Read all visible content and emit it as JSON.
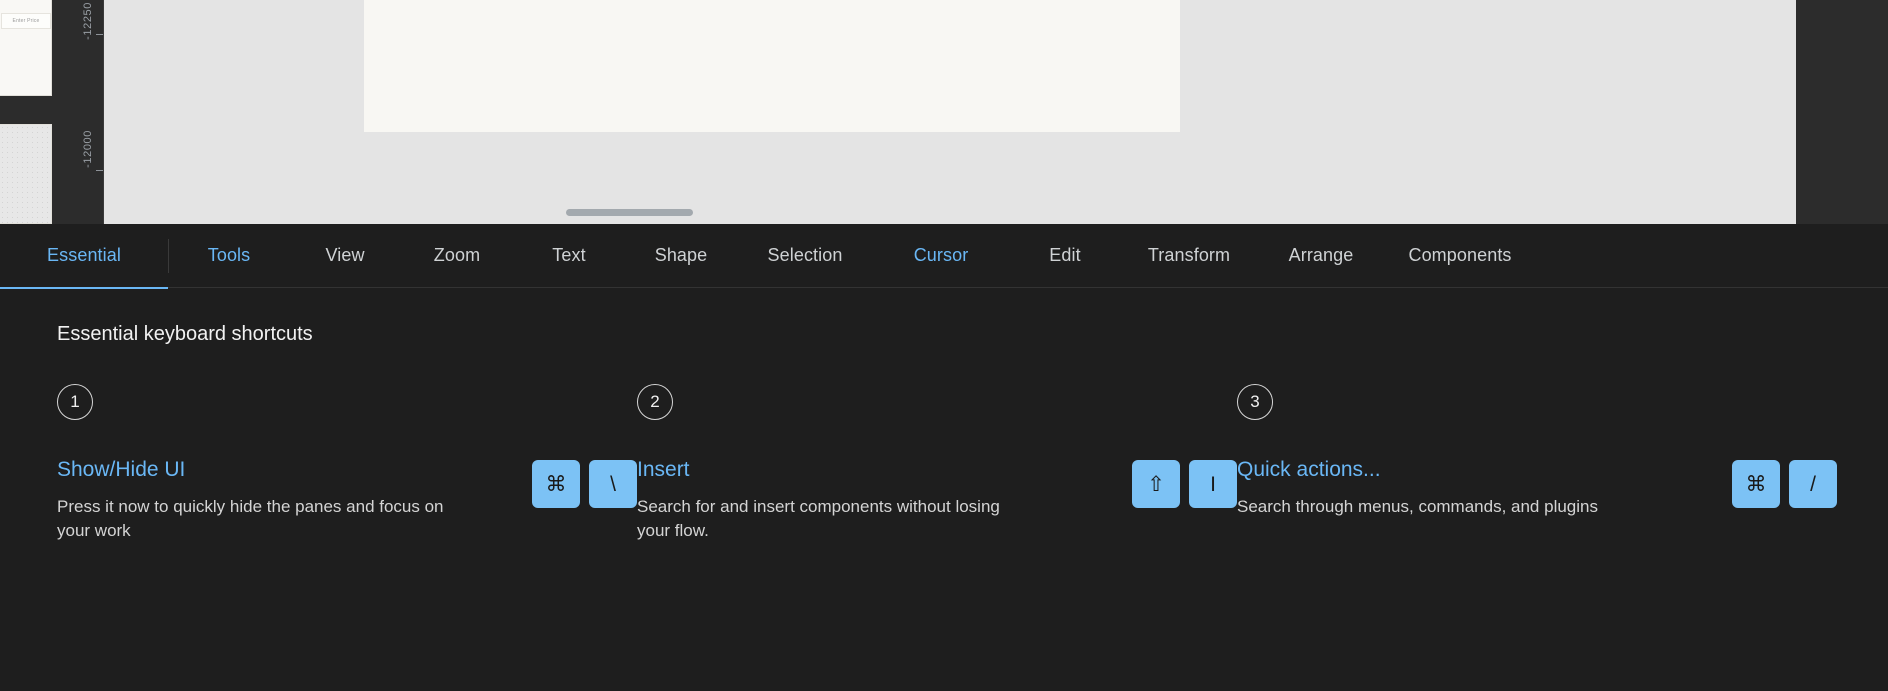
{
  "canvas": {
    "ruler": {
      "labels": [
        "-12250",
        "-12000"
      ]
    },
    "mini_card": {
      "field_placeholder": "Enter Price"
    },
    "expand_button_icon": "chevron-right-icon"
  },
  "tabs": [
    {
      "label": "Essential",
      "state": "active"
    },
    {
      "label": "Tools",
      "state": "accent"
    },
    {
      "label": "View",
      "state": "normal"
    },
    {
      "label": "Zoom",
      "state": "normal"
    },
    {
      "label": "Text",
      "state": "normal"
    },
    {
      "label": "Shape",
      "state": "normal"
    },
    {
      "label": "Selection",
      "state": "normal"
    },
    {
      "label": "Cursor",
      "state": "accent"
    },
    {
      "label": "Edit",
      "state": "normal"
    },
    {
      "label": "Transform",
      "state": "normal"
    },
    {
      "label": "Arrange",
      "state": "normal"
    },
    {
      "label": "Components",
      "state": "normal"
    }
  ],
  "panel": {
    "heading": "Essential keyboard shortcuts",
    "cards": [
      {
        "number": "1",
        "title": "Show/Hide UI",
        "description": "Press it now to quickly hide the panes and focus on your work",
        "keys": [
          {
            "glyph": "⌘",
            "name": "command-key"
          },
          {
            "glyph": "\\",
            "name": "backslash-key"
          }
        ]
      },
      {
        "number": "2",
        "title": "Insert",
        "description": "Search for and insert components without losing your flow.",
        "keys": [
          {
            "glyph": "⇧",
            "name": "shift-key"
          },
          {
            "glyph": "I",
            "name": "letter-i-key"
          }
        ]
      },
      {
        "number": "3",
        "title": "Quick actions...",
        "description": "Search through menus, commands, and plugins",
        "keys": [
          {
            "glyph": "⌘",
            "name": "command-key"
          },
          {
            "glyph": "/",
            "name": "slash-key"
          }
        ]
      }
    ]
  },
  "colors": {
    "accent": "#6ab7f5",
    "key_cap": "#7cc2f5",
    "panel_bg": "#1e1e1e",
    "canvas_bg": "#e4e4e4",
    "artboard": "#f8f7f3"
  }
}
